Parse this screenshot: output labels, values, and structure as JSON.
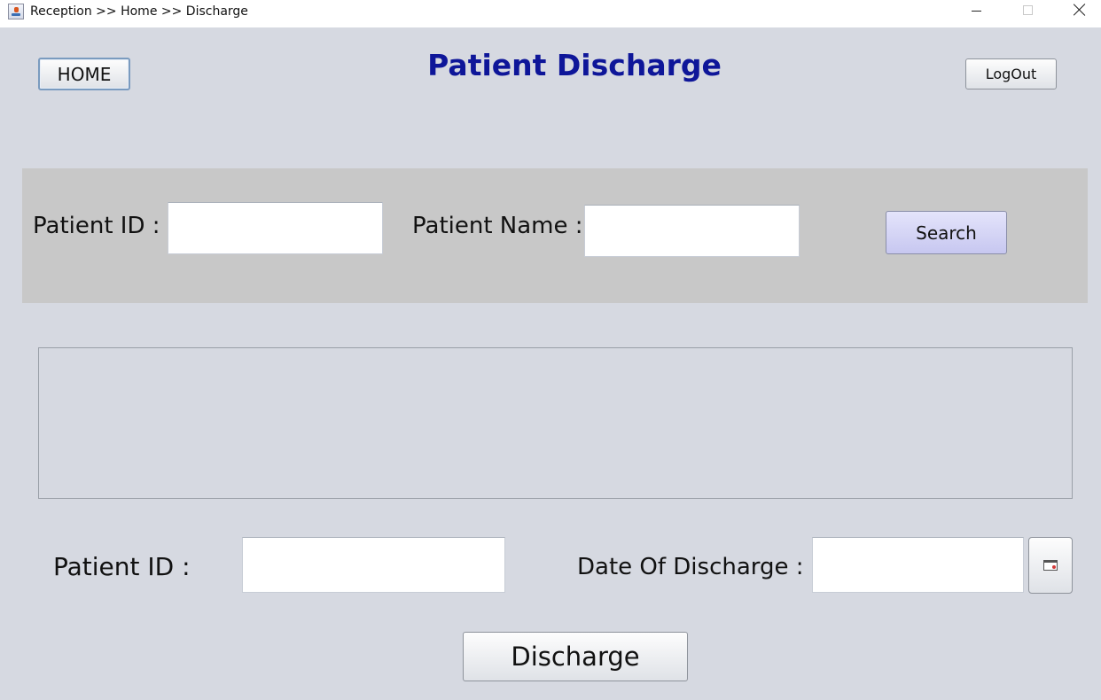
{
  "window": {
    "title": "Reception >> Home >> Discharge"
  },
  "header": {
    "home_label": "HOME",
    "page_title": "Patient Discharge",
    "logout_label": "LogOut"
  },
  "search": {
    "patient_id_label": "Patient ID :",
    "patient_id_value": "",
    "patient_name_label": "Patient Name :",
    "patient_name_value": "",
    "search_label": "Search"
  },
  "results": {
    "rows": []
  },
  "discharge": {
    "patient_id_label": "Patient ID :",
    "patient_id_value": "",
    "date_label": "Date Of Discharge :",
    "date_value": "",
    "calendar_icon": "calendar-icon",
    "discharge_label": "Discharge"
  },
  "colors": {
    "background": "#d6d9e1",
    "title": "#0e1699",
    "search_panel": "#c8c8c8",
    "search_button": "#d4d4f6"
  }
}
